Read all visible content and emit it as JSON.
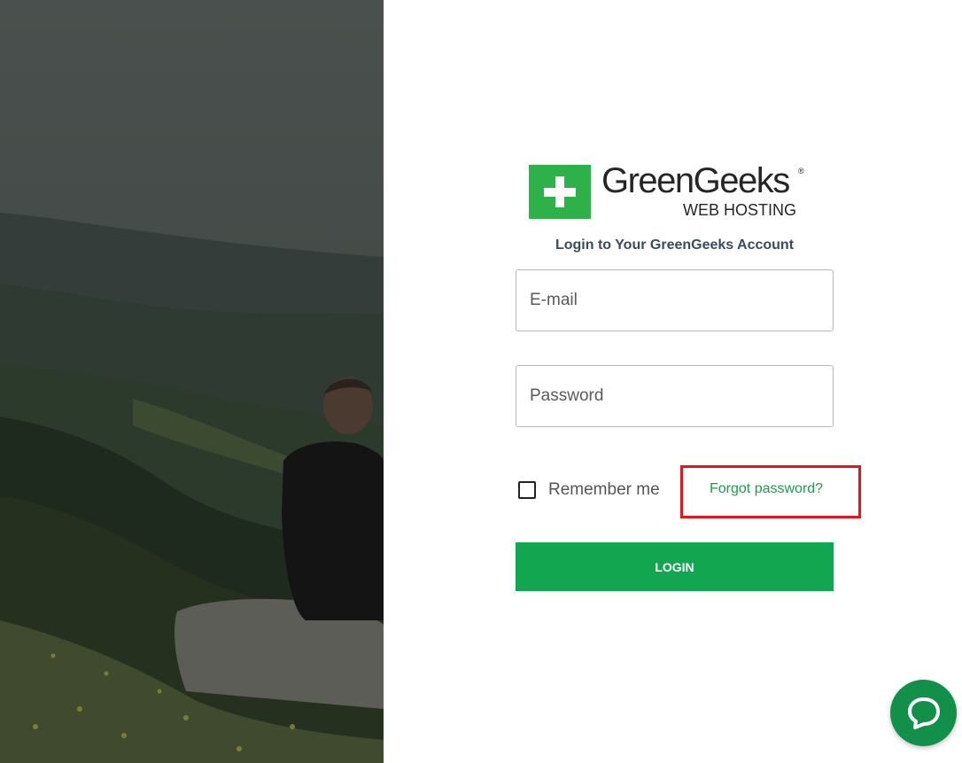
{
  "brand": {
    "logo_name": "GreenGeeks",
    "logo_sub": "WEB HOSTING",
    "registered_mark": "®",
    "accent_color": "#2fb149"
  },
  "login": {
    "subtitle": "Login to Your GreenGeeks Account",
    "email_placeholder": "E-mail",
    "password_placeholder": "Password",
    "remember_label": "Remember me",
    "forgot_label": "Forgot password?",
    "submit_label": "LOGIN",
    "button_color": "#12a650",
    "link_color": "#1f9a49",
    "highlight_color": "#e8131c"
  },
  "chat_widget": {
    "icon": "chat-bubble-icon",
    "color": "#12904a"
  }
}
